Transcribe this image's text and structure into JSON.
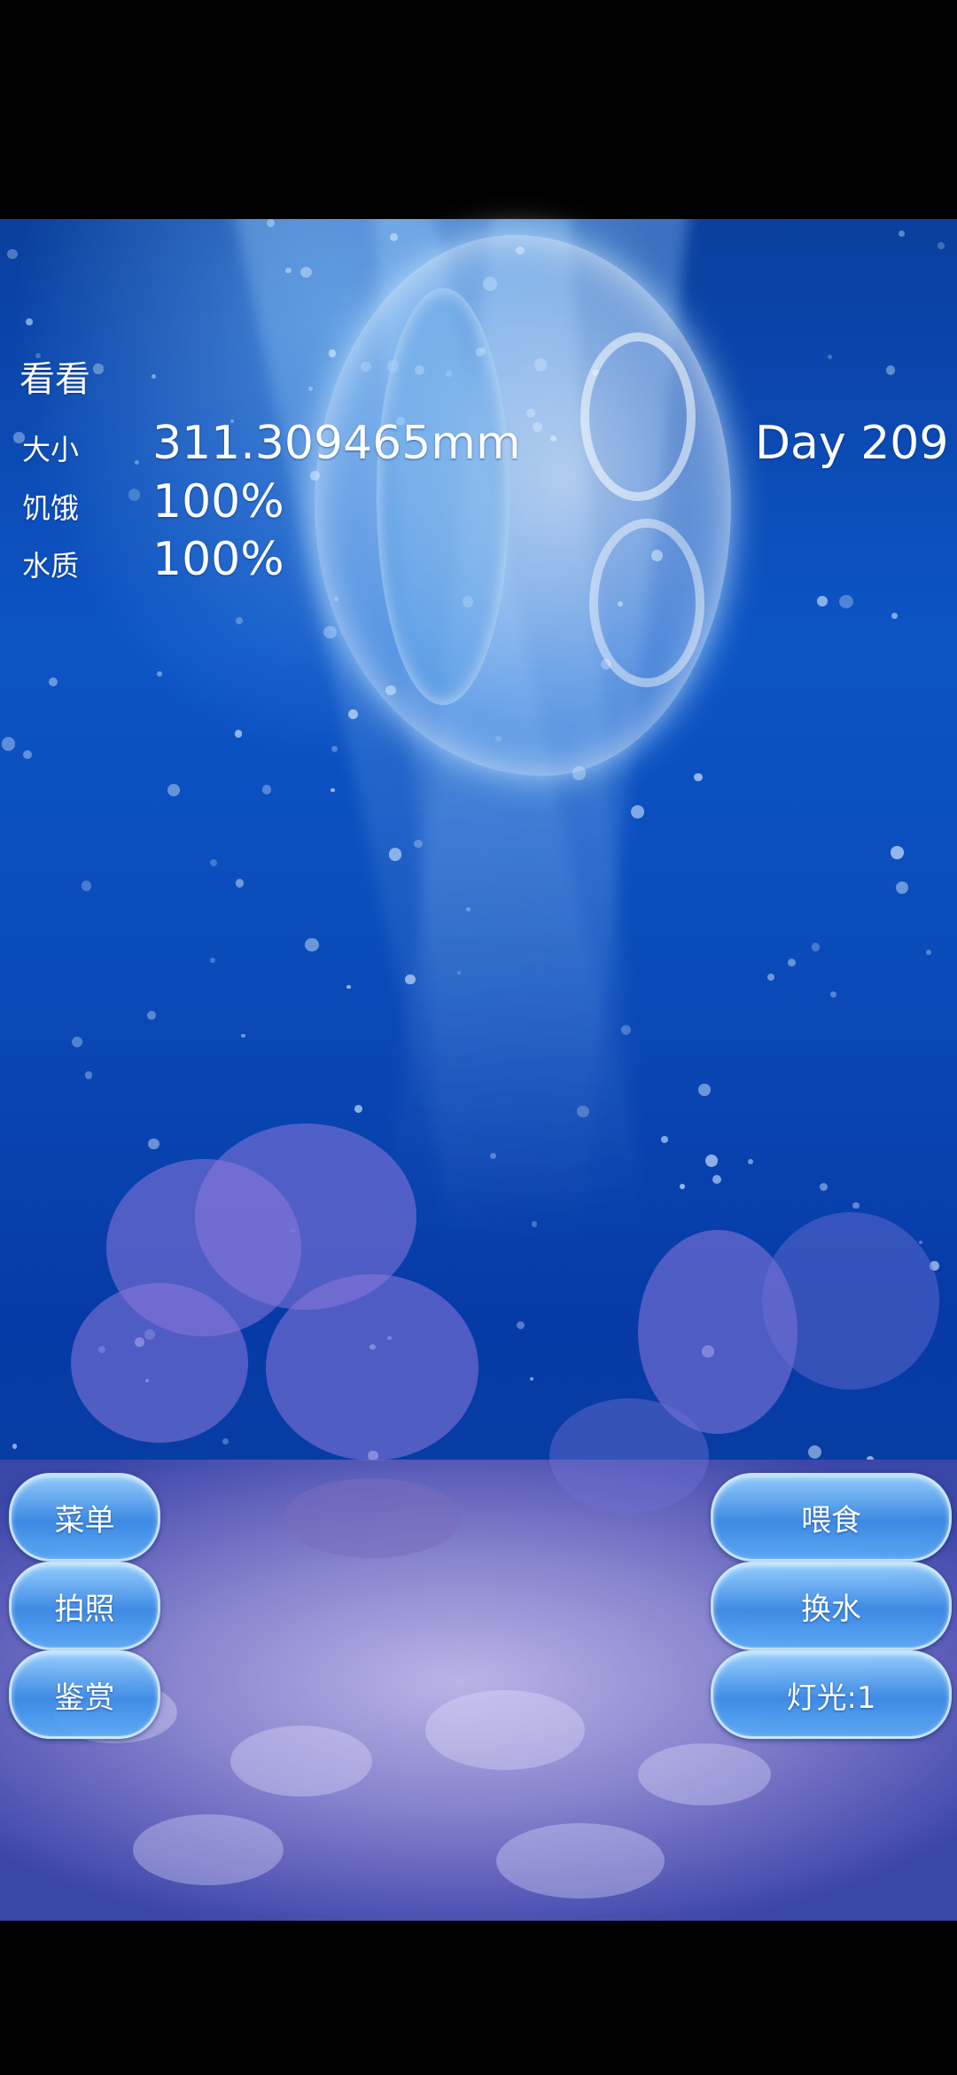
{
  "stats": {
    "title": "看看",
    "size_label": "大小",
    "size_value": "311.309465mm",
    "hunger_label": "饥饿",
    "hunger_value": "100%",
    "water_label": "水质",
    "water_value": "100%",
    "day": "Day 209"
  },
  "buttons": {
    "menu": "菜单",
    "photo": "拍照",
    "appreciate": "鉴赏",
    "feed": "喂食",
    "change_water": "换水",
    "light": "灯光:1"
  },
  "colors": {
    "water_top": "#0a3f9e",
    "water_mid": "#0c54c6",
    "floor": "#b9b4e6",
    "button": "#4a9ae8"
  }
}
